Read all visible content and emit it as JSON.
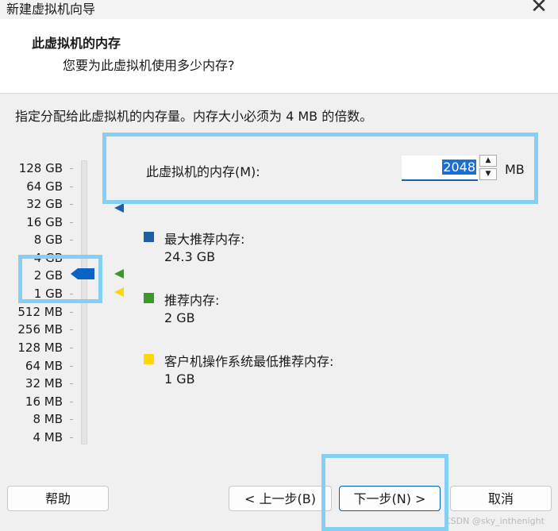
{
  "window": {
    "title": "新建虚拟机向导",
    "close_glyph": "✕"
  },
  "header": {
    "title": "此虚拟机的内存",
    "subtitle": "您要为此虚拟机使用多少内存?"
  },
  "instruction": "指定分配给此虚拟机的内存量。内存大小必须为 4 MB 的倍数。",
  "scale": {
    "labels": [
      "128 GB",
      "64 GB",
      "32 GB",
      "16 GB",
      "8 GB",
      "4 GB",
      "2 GB",
      "1 GB",
      "512 MB",
      "256 MB",
      "128 MB",
      "64 MB",
      "32 MB",
      "16 MB",
      "8 MB",
      "4 MB"
    ],
    "selected_label": "2 GB"
  },
  "memory": {
    "label": "此虚拟机的内存(M):",
    "value": "2048",
    "unit": "MB",
    "spin_up": "▲",
    "spin_down": "▼"
  },
  "legend": [
    {
      "name": "最大推荐内存:",
      "value": "24.3 GB",
      "color": "#1a5fa8"
    },
    {
      "name": "推荐内存:",
      "value": "2 GB",
      "color": "#3a9a28"
    },
    {
      "name": "客户机操作系统最低推荐内存:",
      "value": "1 GB",
      "color": "#ffd60a"
    }
  ],
  "markers": {
    "max_color": "#1a5fa8",
    "recommended_color": "#3a9a28",
    "min_color": "#ffd60a",
    "thumb_color": "#0a64c8"
  },
  "buttons": {
    "help": "帮助",
    "back": "< 上一步(B)",
    "next": "下一步(N) >",
    "cancel": "取消"
  },
  "watermark": "CSDN @sky_inthenight",
  "highlight_color": "#84d0f5"
}
